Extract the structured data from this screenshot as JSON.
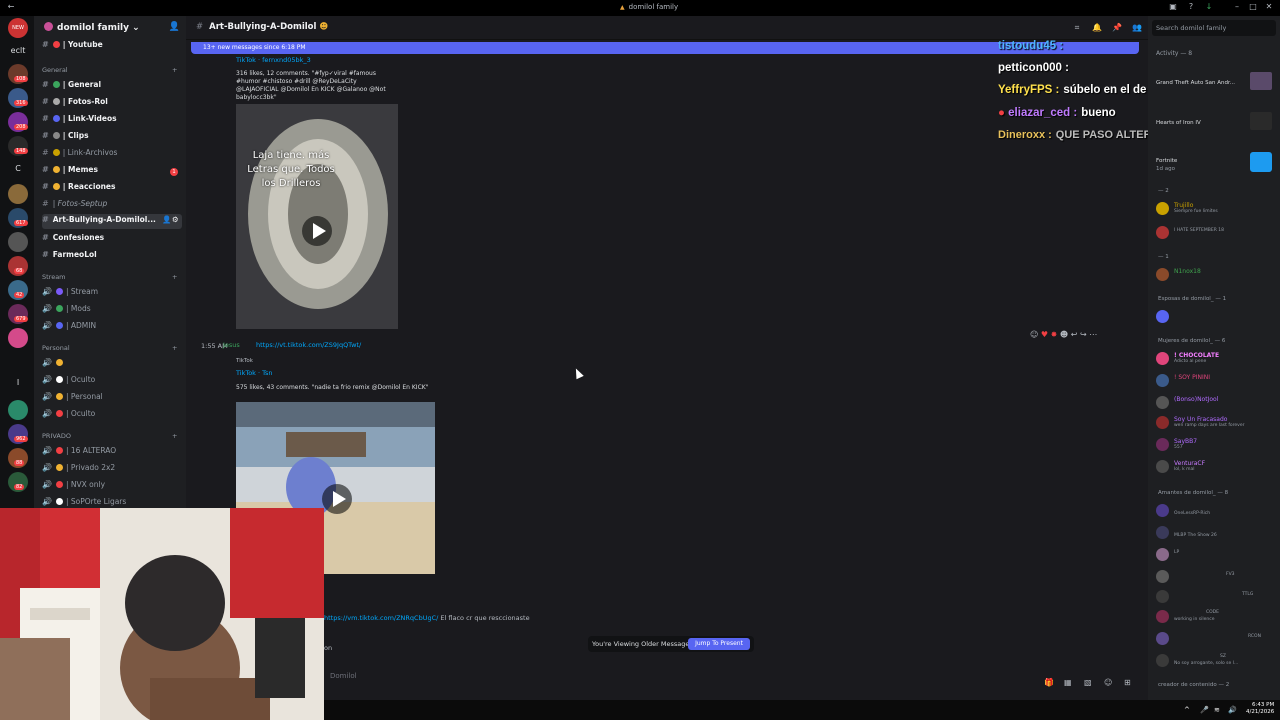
{
  "window": {
    "title": "domilol family"
  },
  "server": {
    "name": "domilol family",
    "new_badge": "NEW",
    "badges": [
      "108",
      "316",
      "208",
      "148",
      "617",
      "68",
      "42",
      "679",
      "962",
      "88",
      "82"
    ]
  },
  "channels": {
    "top": {
      "label": "| Youtube"
    },
    "categories": [
      {
        "name": "General",
        "items": [
          {
            "label": "| General",
            "unread": true
          },
          {
            "label": "| Fotos-Rol",
            "unread": true
          },
          {
            "label": "| Link-Videos",
            "unread": true
          },
          {
            "label": "| Clips",
            "unread": true
          },
          {
            "label": "| Link-Archivos",
            "unread": false
          },
          {
            "label": "| Memes",
            "unread": true,
            "mention": "1"
          },
          {
            "label": "| Reacciones",
            "unread": true
          },
          {
            "label": "| Fotos-Septup",
            "unread": false
          },
          {
            "label": "Art-Bullying-A-Domilol...",
            "active": true
          },
          {
            "label": "Confesiones",
            "unread": true
          },
          {
            "label": "FarmeoLol",
            "unread": true
          }
        ]
      },
      {
        "name": "Stream",
        "items": [
          {
            "label": "| Stream"
          },
          {
            "label": "| Mods"
          },
          {
            "label": "| ADMIN"
          }
        ]
      },
      {
        "name": "Personal",
        "items": [
          {
            "label": ""
          },
          {
            "label": "| Oculto"
          },
          {
            "label": "| Personal"
          },
          {
            "label": "| Oculto"
          }
        ]
      },
      {
        "name": "PRIVADO",
        "items": [
          {
            "label": "| 16 ALTERAO"
          },
          {
            "label": "| Privado 2x2"
          },
          {
            "label": "| NVX only"
          },
          {
            "label": "| SoPOrte Ligars"
          }
        ]
      }
    ]
  },
  "chat": {
    "channel_title": "Art-Bullying-A-Domilol",
    "new_messages": "13+ new messages since 6:18 PM",
    "message1": {
      "embed_title": "TikTok · fernxnd05bk_3",
      "embed_desc": "316 likes, 12 comments. \"#fyp✓viral #famous #humor #chistoso #drill @ReyDeLaCity @LAJAOFICIAL @Domilol En KICK @Galanoo @Not babylocc3bk\"",
      "video_text": "Laja tiene. más Letras que. Todos los Drilleros"
    },
    "message2": {
      "time": "1:55 AM",
      "author": "Jesus",
      "link": "https://vt.tiktok.com/ZS9JqQTwt/",
      "embed_provider": "TikTok",
      "embed_title": "TikTok · Tsn",
      "embed_desc": "575 likes, 43 comments. \"nadie ta frio remix @Domilol En KICK\""
    },
    "message3": {
      "link": "https://vm.tiktok.com/ZNRqCbUgC/",
      "text": "El flaco cr que resccionaste",
      "trail": "on"
    },
    "older_notice": "You're Viewing Older Messages",
    "jump_label": "Jump To Present",
    "composer_placeholder": "Domilol"
  },
  "stream_overlay": [
    {
      "user": "tistoudu45 :",
      "color": "#4fb5ff",
      "msg": ""
    },
    {
      "user": "petticon000 :",
      "color": "#ffffff",
      "msg": ""
    },
    {
      "user": "YeffryFPS :",
      "color": "#ffe14d",
      "msg": "súbelo en el de música y en el grande su"
    },
    {
      "user": "eliazar_ced :",
      "color": "#c07bff",
      "msg": "bueno"
    },
    {
      "user": "Dineroxx :",
      "color": "#e8c15b",
      "msg": "QUE PASO ALTERAO PARODIA"
    }
  ],
  "members": {
    "search_placeholder": "Search domilol family",
    "activity_header": "Activity — 8",
    "activities": [
      {
        "name": "Grand Theft Auto San Andr..."
      },
      {
        "name": "Hearts of Iron IV"
      },
      {
        "name": "Fortnite",
        "sub": "1d ago"
      }
    ],
    "groups": [
      {
        "label": "— 2",
        "members": [
          {
            "name": "Trujillo",
            "tag": "Admin",
            "status": "Siempre fue limites",
            "color": "#c9a100"
          },
          {
            "name": "",
            "status": "I HATE SEPTEMBER 18",
            "color": "#ffffff"
          }
        ]
      },
      {
        "label": "— 1",
        "members": [
          {
            "name": "N1nox18",
            "tag": "SAB",
            "color": "#3fa14d"
          }
        ]
      },
      {
        "label": "Esposas de domilol_ — 1",
        "members": [
          {
            "name": "",
            "color": "#5865f2"
          }
        ]
      },
      {
        "label": "Mujeres de domilol_ — 6",
        "members": [
          {
            "name": "! CHOCOLATE",
            "status": "Adicto al pene",
            "color": "#f47fff"
          },
          {
            "name": "! SOY PININI",
            "color": "#e0457b"
          },
          {
            "name": "(Bonso)NotJool",
            "tag": "RISK",
            "color": "#b06bff"
          },
          {
            "name": "Soy Un Fracasado",
            "status": "wen ramp days are last forever",
            "color": "#b06bff"
          },
          {
            "name": "SayBB7",
            "tag": "FV3",
            "status": "557",
            "color": "#b06bff"
          },
          {
            "name": "VenturaCF",
            "tag": "Admin",
            "status": "lol, k mal",
            "color": "#c87bff"
          }
        ]
      },
      {
        "label": "Amantes de domilol_ — 8",
        "members": [
          {
            "name": "",
            "status": "OneLessRP-Rich",
            "color": "#e0457b"
          },
          {
            "name": "",
            "status": "MLBP The Show 26",
            "color": "#e0457b"
          },
          {
            "name": "",
            "tag": "LP",
            "color": "#e0457b"
          },
          {
            "name": "",
            "tag": "FV3",
            "color": "#e0457b"
          },
          {
            "name": "",
            "tag": "TTLG",
            "color": "#e0457b"
          },
          {
            "name": "",
            "tag": "CODE",
            "status": "working in silence",
            "color": "#e0457b"
          },
          {
            "name": "",
            "tag": "RCON",
            "color": "#e0457b"
          },
          {
            "name": "",
            "tag": "SZ",
            "status": "No soy arrogante, solo se l...",
            "color": "#e0457b"
          }
        ]
      },
      {
        "label": "creador de contenido — 2",
        "members": []
      }
    ]
  },
  "taskbar": {
    "time": "6:43 PM",
    "date": "4/21/2026"
  },
  "colors": {
    "accent": "#5865f2",
    "link": "#00a8fc",
    "mention": "#f23f43"
  }
}
